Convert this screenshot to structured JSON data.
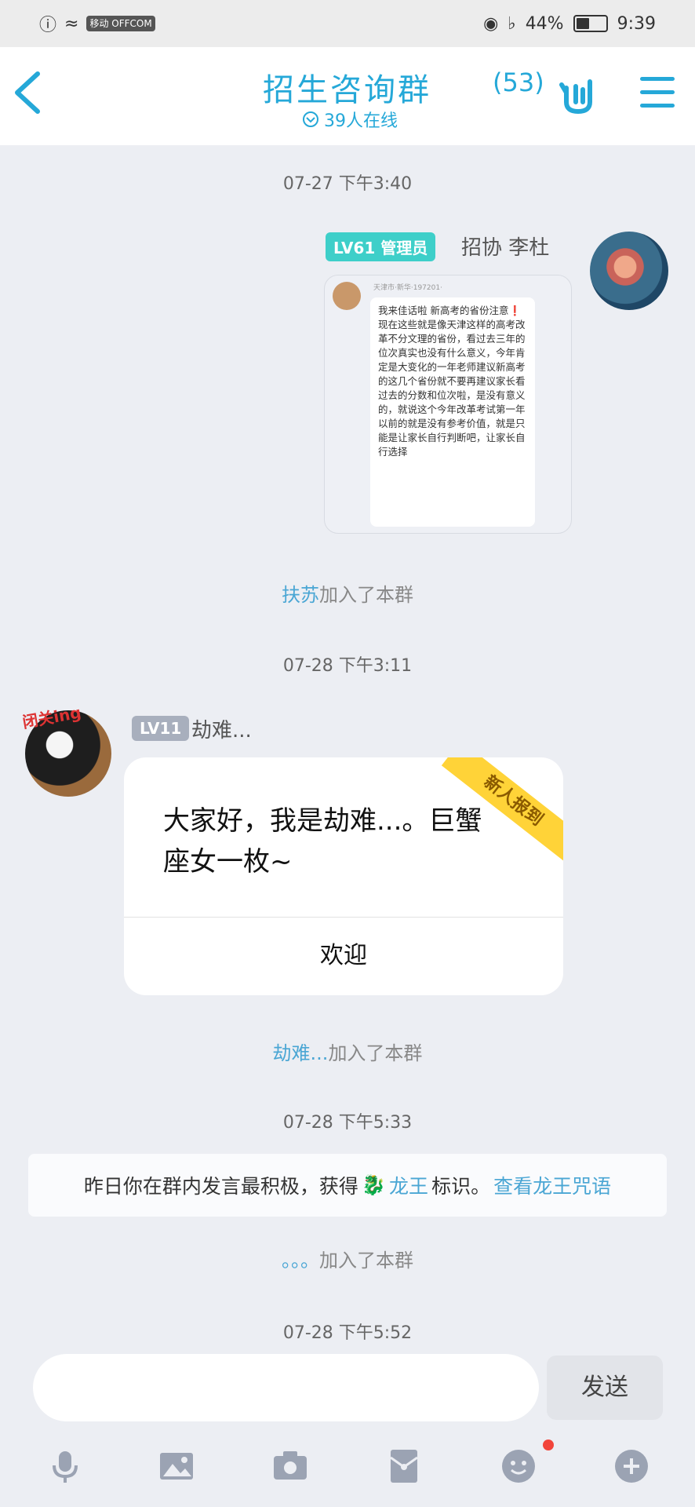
{
  "status_bar": {
    "carrier_badge": "移动 OFFCOM",
    "battery": "44%",
    "battery_level": 0.44,
    "time": "9:39"
  },
  "header": {
    "title": "招生咨询群",
    "member_count": "(53)",
    "online": "39人在线"
  },
  "messages": {
    "ts1": "07-27 下午3:40",
    "msg1": {
      "level": "LV61",
      "role": "管理员",
      "sender": "招协 李杜",
      "image_header": "天津市·新华·197201·",
      "image_text": "我来佳话啦 新高考的省份注意❗现在这些就是像天津这样的高考改革不分文理的省份，看过去三年的位次真实也没有什么意义，今年肯定是大变化的一年老师建议新高考的这几个省份就不要再建议家长看过去的分数和位次啦，是没有意义的，就说这个今年改革考试第一年以前的就是没有参考价值，就是只能是让家长自行判断吧，让家长自行选择"
    },
    "sys1": {
      "name": "扶苏",
      "text": "加入了本群"
    },
    "ts2": "07-28 下午3:11",
    "msg2": {
      "badge": "闭关ing",
      "level": "LV11",
      "sender": "劫难...",
      "ribbon": "新人报到",
      "text": "大家好，我是劫难...。巨蟹座女一枚~",
      "button": "欢迎"
    },
    "sys2": {
      "name": "劫难...",
      "text": "加入了本群"
    },
    "ts3": "07-28 下午5:33",
    "banner": {
      "text1": "昨日你在群内发言最积极，获得",
      "dragon": "龙王",
      "text2": "标识。",
      "link": "查看龙王咒语"
    },
    "sys3": {
      "name": "。。。",
      "text": "加入了本群"
    },
    "ts4": "07-28 下午5:52"
  },
  "input": {
    "send_label": "发送"
  },
  "toolbar": [
    "mic-icon",
    "image-icon",
    "camera-icon",
    "red-packet-icon",
    "emoji-icon",
    "plus-icon"
  ]
}
